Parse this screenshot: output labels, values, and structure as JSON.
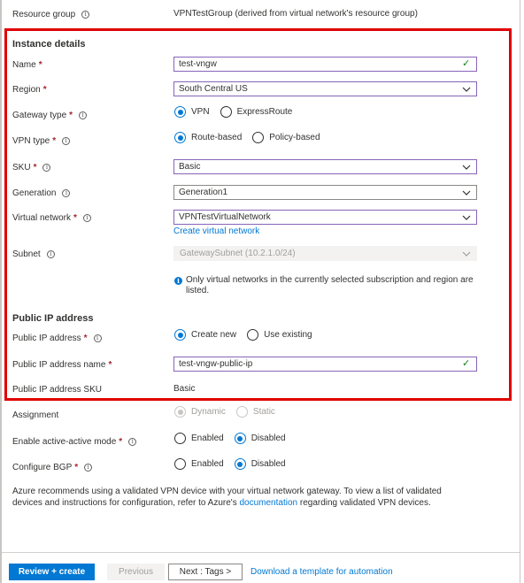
{
  "resource_group": {
    "label": "Resource group",
    "value": "VPNTestGroup (derived from virtual network's resource group)"
  },
  "instance_details": {
    "title": "Instance details",
    "name": {
      "label": "Name",
      "value": "test-vngw"
    },
    "region": {
      "label": "Region",
      "value": "South Central US"
    },
    "gateway_type": {
      "label": "Gateway type",
      "options": [
        "VPN",
        "ExpressRoute"
      ],
      "selected": "VPN"
    },
    "vpn_type": {
      "label": "VPN type",
      "options": [
        "Route-based",
        "Policy-based"
      ],
      "selected": "Route-based"
    },
    "sku": {
      "label": "SKU",
      "value": "Basic"
    },
    "generation": {
      "label": "Generation",
      "value": "Generation1"
    },
    "virtual_network": {
      "label": "Virtual network",
      "value": "VPNTestVirtualNetwork",
      "create_link": "Create virtual network"
    },
    "subnet": {
      "label": "Subnet",
      "value": "GatewaySubnet (10.2.1.0/24)"
    },
    "info_note": "Only virtual networks in the currently selected subscription and region are",
    "info_note_2": "listed."
  },
  "public_ip": {
    "title": "Public IP address",
    "address": {
      "label": "Public IP address",
      "options": [
        "Create new",
        "Use existing"
      ],
      "selected": "Create new"
    },
    "name": {
      "label": "Public IP address name",
      "value": "test-vngw-public-ip"
    },
    "sku": {
      "label": "Public IP address SKU",
      "value": "Basic"
    },
    "assignment": {
      "label": "Assignment",
      "options": [
        "Dynamic",
        "Static"
      ],
      "selected": "Dynamic"
    },
    "active_active": {
      "label": "Enable active-active mode",
      "options": [
        "Enabled",
        "Disabled"
      ],
      "selected": "Disabled"
    },
    "bgp": {
      "label": "Configure BGP",
      "options": [
        "Enabled",
        "Disabled"
      ],
      "selected": "Disabled"
    }
  },
  "recommendation": {
    "text_1": "Azure recommends using a validated VPN device with your virtual network gateway. To view a list of validated devices and instructions for configuration, refer to Azure's ",
    "link": "documentation",
    "text_2": " regarding validated VPN devices."
  },
  "footer": {
    "review_create": "Review + create",
    "previous": "Previous",
    "next": "Next : Tags >",
    "download": "Download a template for automation"
  },
  "colors": {
    "accent": "#0078d4",
    "highlight_box": "#e00000",
    "valid_check": "#107c10",
    "focus_border": "#8764b8"
  }
}
